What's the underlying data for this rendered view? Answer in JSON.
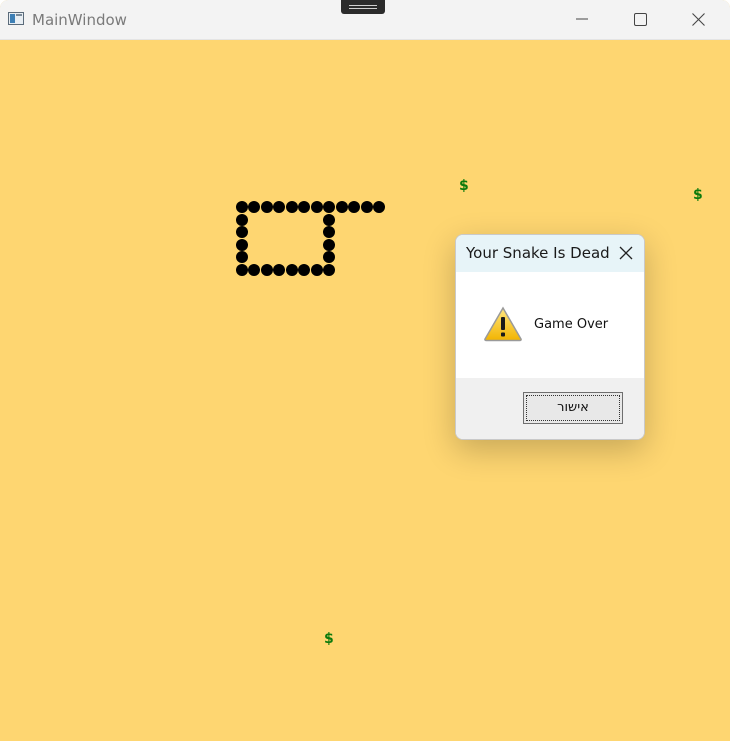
{
  "window": {
    "title": "MainWindow"
  },
  "dialog": {
    "title": "Your Snake Is Dead",
    "message": "Game Over",
    "ok_label": "אישור"
  },
  "game": {
    "food_symbol": "$",
    "snake_color": "#000000",
    "board_color": "#fed671",
    "food_color": "#0c7a0c"
  }
}
